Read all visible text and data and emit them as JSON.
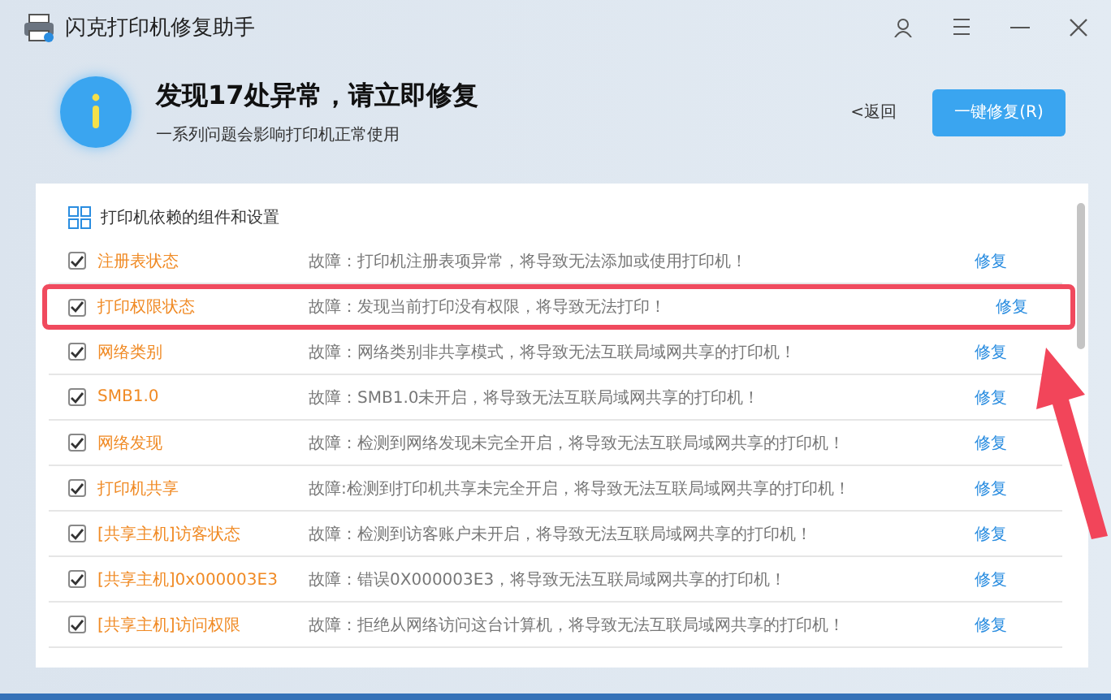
{
  "window": {
    "title": "闪克打印机修复助手"
  },
  "header": {
    "title": "发现17处异常，请立即修复",
    "subtitle": "一系列问题会影响打印机正常使用",
    "back": "<返回",
    "fix_all": "一键修复(R)"
  },
  "panel": {
    "title": "打印机依赖的组件和设置",
    "rows": [
      {
        "name": "注册表状态",
        "desc": "故障：打印机注册表项异常，将导致无法添加或使用打印机！",
        "action": "修复",
        "checked": true,
        "highlighted": false
      },
      {
        "name": "打印权限状态",
        "desc": "故障：发现当前打印没有权限，将导致无法打印！",
        "action": "修复",
        "checked": true,
        "highlighted": true
      },
      {
        "name": "网络类别",
        "desc": "故障：网络类别非共享模式，将导致无法互联局域网共享的打印机！",
        "action": "修复",
        "checked": true,
        "highlighted": false
      },
      {
        "name": "SMB1.0",
        "desc": "故障：SMB1.0未开启，将导致无法互联局域网共享的打印机！",
        "action": "修复",
        "checked": true,
        "highlighted": false
      },
      {
        "name": "网络发现",
        "desc": "故障：检测到网络发现未完全开启，将导致无法互联局域网共享的打印机！",
        "action": "修复",
        "checked": true,
        "highlighted": false
      },
      {
        "name": "打印机共享",
        "desc": "故障:检测到打印机共享未完全开启，将导致无法互联局域网共享的打印机！",
        "action": "修复",
        "checked": true,
        "highlighted": false
      },
      {
        "name": "[共享主机]访客状态",
        "desc": "故障：检测到访客账户未开启，将导致无法互联局域网共享的打印机！",
        "action": "修复",
        "checked": true,
        "highlighted": false
      },
      {
        "name": "[共享主机]0x000003E3",
        "desc": "故障：错误0X000003E3，将导致无法互联局域网共享的打印机！",
        "action": "修复",
        "checked": true,
        "highlighted": false
      },
      {
        "name": "[共享主机]访问权限",
        "desc": "故障：拒绝从网络访问这台计算机，将导致无法互联局域网共享的打印机！",
        "action": "修复",
        "checked": true,
        "highlighted": false
      }
    ]
  }
}
